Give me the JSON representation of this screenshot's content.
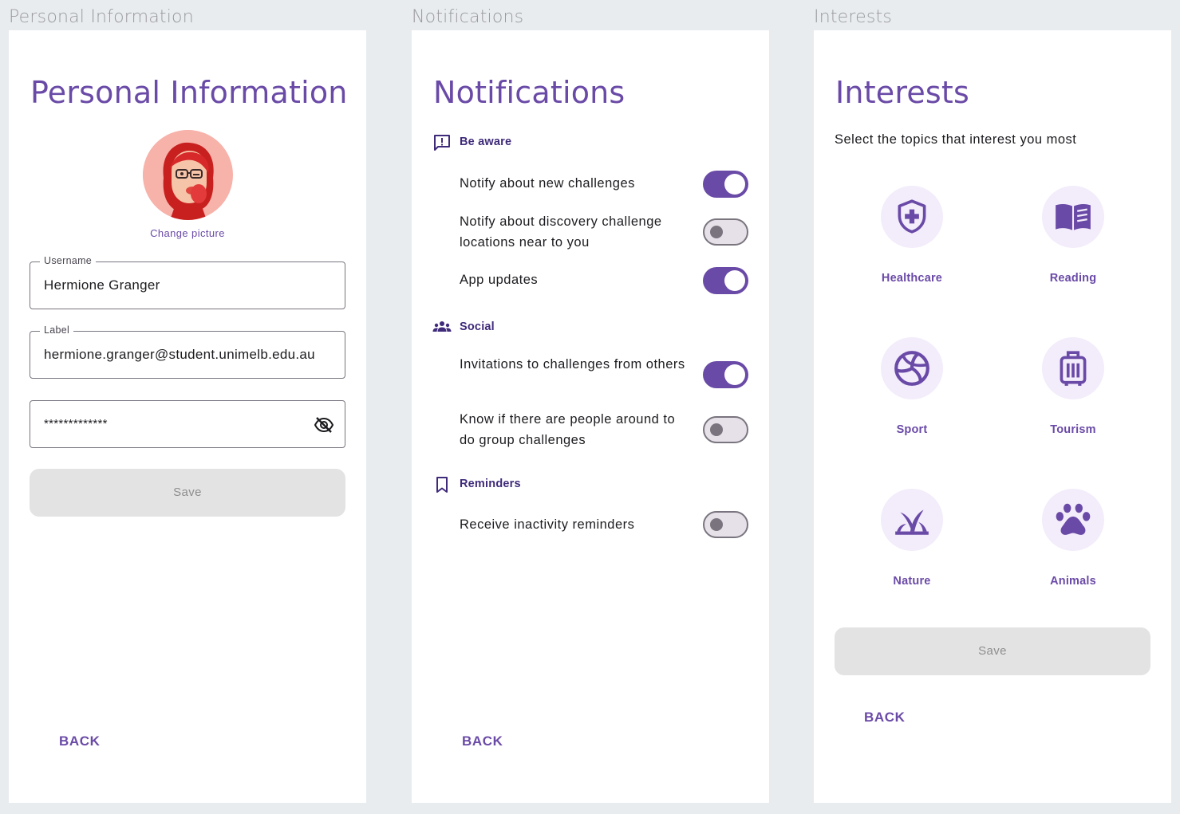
{
  "frames": {
    "personal": "Personal Information",
    "notifications": "Notifications",
    "interests": "Interests"
  },
  "personal": {
    "title": "Personal Information",
    "change_picture": "Change picture",
    "username_label": "Username",
    "username_value": "Hermione Granger",
    "email_label": "Label",
    "email_value": "hermione.granger@student.unimelb.edu.au",
    "password_value": "*************",
    "save": "Save",
    "back": "BACK"
  },
  "notifications": {
    "title": "Notifications",
    "sections": [
      {
        "icon": "report-icon",
        "label": "Be aware"
      },
      {
        "icon": "groups-icon",
        "label": "Social"
      },
      {
        "icon": "bookmark-icon",
        "label": "Reminders"
      }
    ],
    "rows": [
      {
        "label": "Notify about new challenges",
        "on": true
      },
      {
        "label": "Notify about discovery challenge locations near to you",
        "on": false
      },
      {
        "label": "App updates",
        "on": true
      },
      {
        "label": "Invitations to challenges from others",
        "on": true
      },
      {
        "label": "Know if there are people around to do group challenges",
        "on": false
      },
      {
        "label": "Receive inactivity reminders",
        "on": false
      }
    ],
    "back": "BACK"
  },
  "interests": {
    "title": "Interests",
    "subtitle": "Select the topics that interest you most",
    "items": [
      {
        "label": "Healthcare",
        "icon": "shield-plus-icon"
      },
      {
        "label": "Reading",
        "icon": "book-icon"
      },
      {
        "label": "Sport",
        "icon": "volleyball-icon"
      },
      {
        "label": "Tourism",
        "icon": "luggage-icon"
      },
      {
        "label": "Nature",
        "icon": "grass-icon"
      },
      {
        "label": "Animals",
        "icon": "paw-icon"
      }
    ],
    "save": "Save",
    "back": "BACK"
  },
  "colors": {
    "accent": "#6a4aa7",
    "accent_dark": "#3f2b7a",
    "icon_bg": "#f3ecfb",
    "disabled_btn": "#e3e3e3",
    "avatar_bg": "#f7b2aa"
  }
}
